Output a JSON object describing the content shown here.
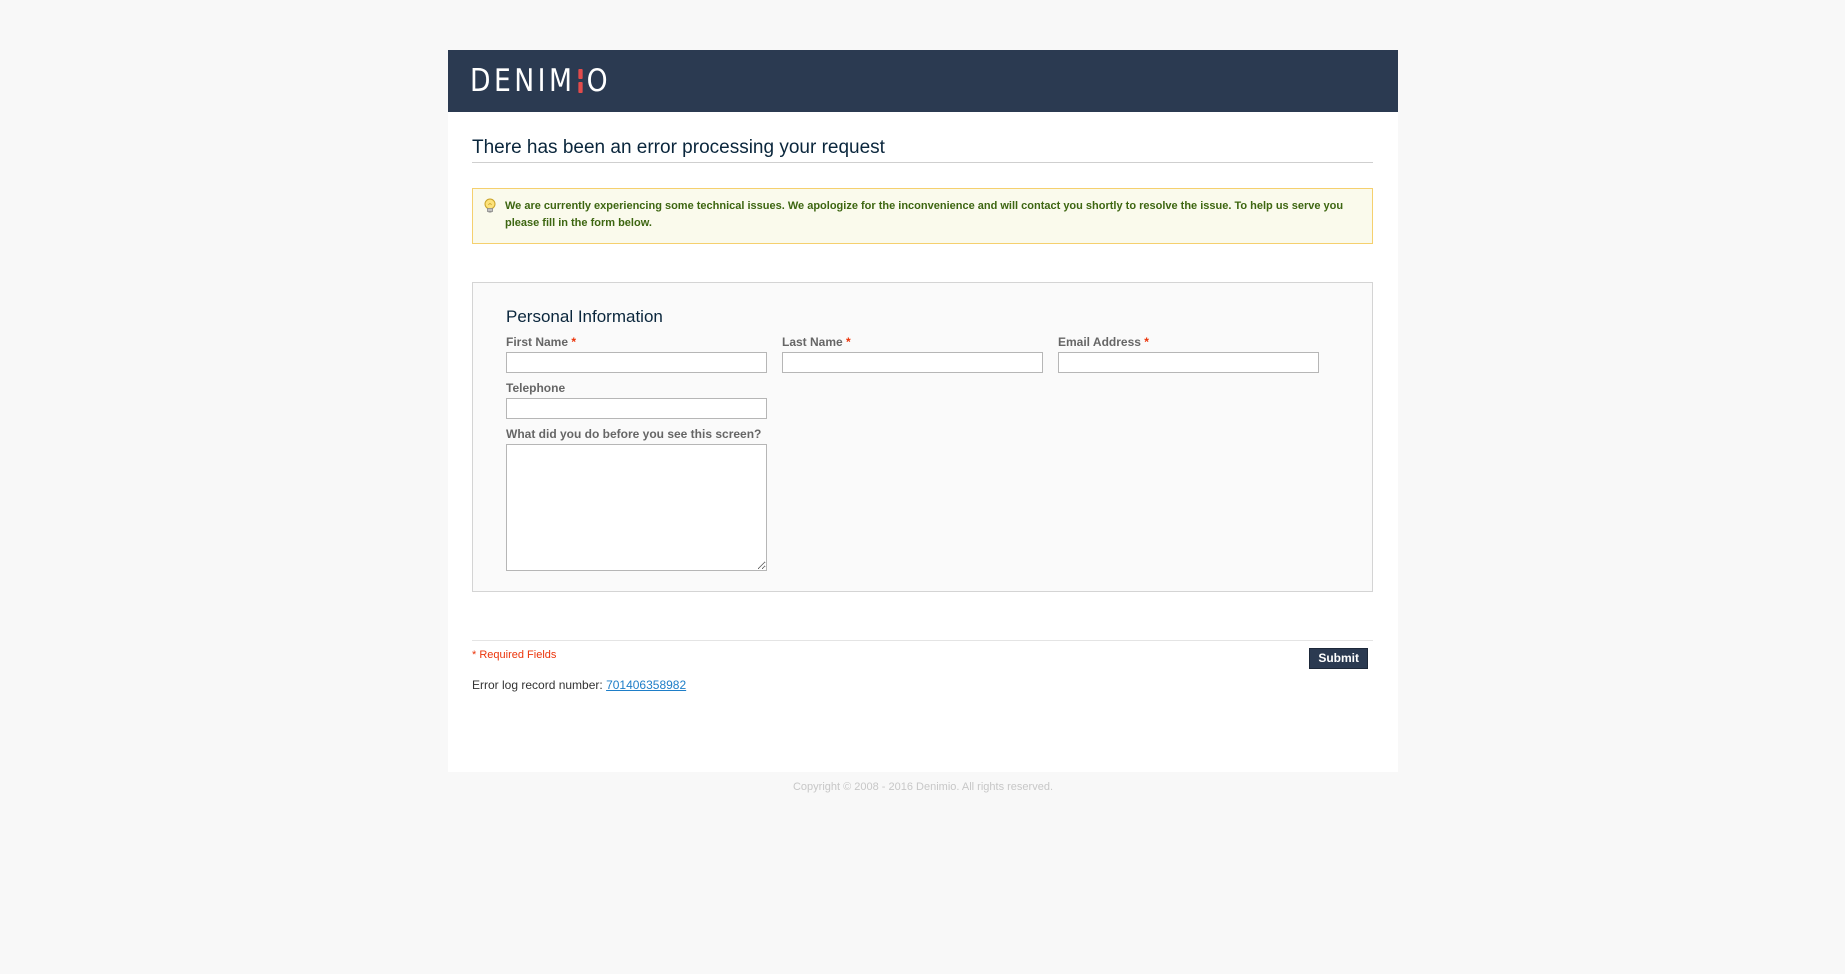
{
  "header": {
    "logo_text_left": "DENIM",
    "logo_text_right": "O",
    "logo_accent_color": "#e24b4b",
    "background_color": "#2b3a51"
  },
  "page": {
    "title": "There has been an error processing your request"
  },
  "notice": {
    "icon": "lightbulb-icon",
    "message": "We are currently experiencing some technical issues. We apologize for the inconvenience and will contact you shortly to resolve the issue. To help us serve you please fill in the form below."
  },
  "form": {
    "legend": "Personal Information",
    "required_marker": "*",
    "fields": {
      "first_name": {
        "label": "First Name",
        "value": ""
      },
      "last_name": {
        "label": "Last Name",
        "value": ""
      },
      "email": {
        "label": "Email Address",
        "value": ""
      },
      "telephone": {
        "label": "Telephone",
        "value": ""
      },
      "comment": {
        "label": "What did you do before you see this screen?",
        "value": ""
      }
    },
    "required_note": "* Required Fields",
    "submit_label": "Submit"
  },
  "error_log": {
    "label": "Error log record number:",
    "record_number": "701406358982"
  },
  "footer": {
    "copyright": "Copyright © 2008 - 2016 Denimio. All rights reserved."
  }
}
